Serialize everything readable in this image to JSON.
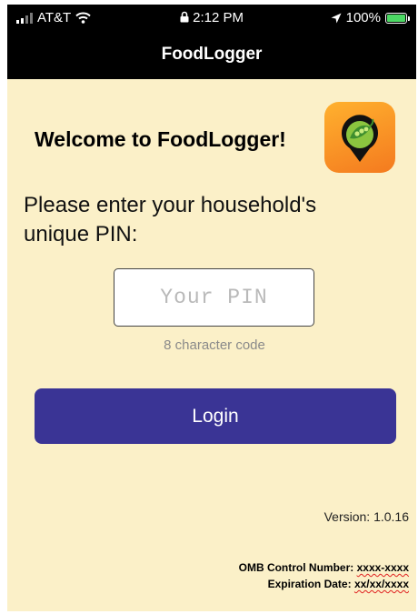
{
  "status_bar": {
    "carrier": "AT&T",
    "time": "2:12 PM",
    "battery_percent": "100%",
    "battery_level": 1.0,
    "battery_color": "#4cd964"
  },
  "header": {
    "title": "FoodLogger"
  },
  "main": {
    "welcome_text": "Welcome to FoodLogger!",
    "app_icon": "map-pin-pea-pod-icon",
    "prompt": "Please enter your household's unique PIN:",
    "pin_placeholder": "Your PIN",
    "pin_value": "",
    "pin_hint": "8 character code",
    "login_label": "Login",
    "login_color": "#3a3495"
  },
  "footer": {
    "version": "Version: 1.0.16",
    "omb_label": "OMB Control Number: ",
    "omb_value": "xxxx-xxxx",
    "expiration_label": "Expiration Date: ",
    "expiration_value": "xx/xx/xxxx"
  },
  "colors": {
    "background": "#fbf0c8",
    "header_bg": "#000000",
    "icon_gradient_top": "#ffb12e",
    "icon_gradient_bottom": "#f47a1f"
  }
}
